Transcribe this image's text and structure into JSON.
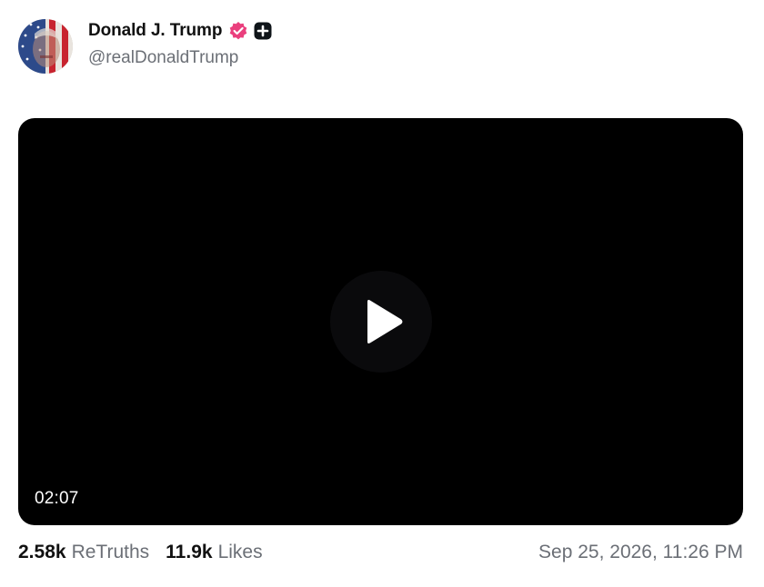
{
  "author": {
    "display_name": "Donald J. Trump",
    "handle": "@realDonaldTrump",
    "verified_icon": "verified-badge-icon",
    "verified_color": "#ea3f7d",
    "extra_badge_icon": "plus-square-icon"
  },
  "video": {
    "duration": "02:07",
    "play_icon": "play-icon",
    "background": "#000000"
  },
  "stats": {
    "retruths_count": "2.58k",
    "retruths_label": "ReTruths",
    "likes_count": "11.9k",
    "likes_label": "Likes"
  },
  "timestamp": "Sep 25, 2026, 11:26 PM"
}
